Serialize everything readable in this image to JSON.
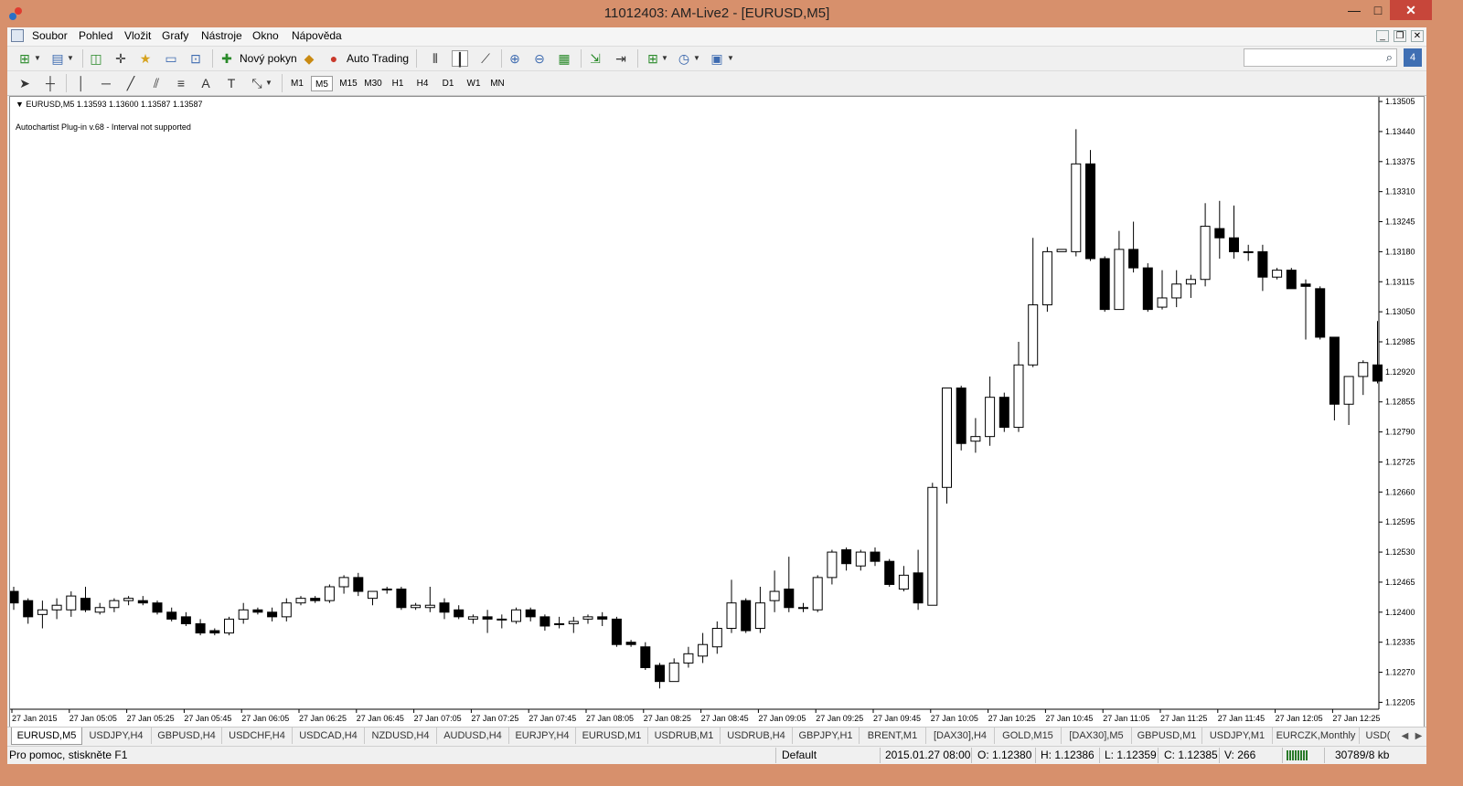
{
  "window": {
    "title": "11012403: AM-Live2 - [EURUSD,M5]",
    "minimize_icon": "minimize-icon",
    "maximize_icon": "maximize-icon",
    "close_icon": "close-icon"
  },
  "menu": {
    "items": [
      "Soubor",
      "Pohled",
      "Vložit",
      "Grafy",
      "Nástroje",
      "Okno",
      "Nápověda"
    ]
  },
  "toolbar": {
    "new_order_label": "Nový pokyn",
    "auto_trading_label": "Auto Trading",
    "search_placeholder": ""
  },
  "timeframes": {
    "items": [
      "M1",
      "M5",
      "M15",
      "M30",
      "H1",
      "H4",
      "D1",
      "W1",
      "MN"
    ],
    "active": "M5"
  },
  "chart": {
    "header": "EURUSD,M5  1.13593 1.13600 1.13587 1.13587",
    "subtitle": "Autochartist Plug-in v.68 - Interval not supported"
  },
  "chart_data": {
    "type": "candlestick",
    "symbol": "EURUSD,M5",
    "ylim": [
      1.1219,
      1.13515
    ],
    "y_ticks": [
      "1.13505",
      "1.13440",
      "1.13375",
      "1.13310",
      "1.13245",
      "1.13180",
      "1.13115",
      "1.13050",
      "1.12985",
      "1.12920",
      "1.12855",
      "1.12790",
      "1.12725",
      "1.12660",
      "1.12595",
      "1.12530",
      "1.12465",
      "1.12400",
      "1.12335",
      "1.12270",
      "1.12205"
    ],
    "x_ticks": [
      "27 Jan 2015",
      "27 Jan 05:05",
      "27 Jan 05:25",
      "27 Jan 05:45",
      "27 Jan 06:05",
      "27 Jan 06:25",
      "27 Jan 06:45",
      "27 Jan 07:05",
      "27 Jan 07:25",
      "27 Jan 07:45",
      "27 Jan 08:05",
      "27 Jan 08:25",
      "27 Jan 08:45",
      "27 Jan 09:05",
      "27 Jan 09:25",
      "27 Jan 09:45",
      "27 Jan 10:05",
      "27 Jan 10:25",
      "27 Jan 10:45",
      "27 Jan 11:05",
      "27 Jan 11:25",
      "27 Jan 11:45",
      "27 Jan 12:05",
      "27 Jan 12:25"
    ],
    "grid": false,
    "candles": [
      [
        1.12445,
        1.12455,
        1.12405,
        1.1242
      ],
      [
        1.12425,
        1.1243,
        1.12375,
        1.1239
      ],
      [
        1.12395,
        1.12425,
        1.12365,
        1.12405
      ],
      [
        1.12405,
        1.1243,
        1.12385,
        1.12415
      ],
      [
        1.12405,
        1.12445,
        1.1239,
        1.12435
      ],
      [
        1.1243,
        1.12455,
        1.124,
        1.12405
      ],
      [
        1.124,
        1.1242,
        1.12395,
        1.1241
      ],
      [
        1.1241,
        1.1243,
        1.124,
        1.12425
      ],
      [
        1.12425,
        1.12435,
        1.12415,
        1.1243
      ],
      [
        1.12425,
        1.12435,
        1.12415,
        1.1242
      ],
      [
        1.1242,
        1.12425,
        1.12395,
        1.124
      ],
      [
        1.124,
        1.1241,
        1.1238,
        1.12385
      ],
      [
        1.1239,
        1.124,
        1.1237,
        1.12375
      ],
      [
        1.12375,
        1.12385,
        1.1235,
        1.12355
      ],
      [
        1.1236,
        1.12365,
        1.1235,
        1.12355
      ],
      [
        1.12355,
        1.1239,
        1.1235,
        1.12385
      ],
      [
        1.12385,
        1.1242,
        1.12375,
        1.12405
      ],
      [
        1.12405,
        1.1241,
        1.12395,
        1.124
      ],
      [
        1.124,
        1.1241,
        1.1238,
        1.1239
      ],
      [
        1.1239,
        1.1243,
        1.1238,
        1.1242
      ],
      [
        1.1242,
        1.12435,
        1.12415,
        1.1243
      ],
      [
        1.1243,
        1.12435,
        1.1242,
        1.12425
      ],
      [
        1.12425,
        1.1246,
        1.1242,
        1.12455
      ],
      [
        1.12455,
        1.1248,
        1.1244,
        1.12475
      ],
      [
        1.12475,
        1.12485,
        1.12435,
        1.12445
      ],
      [
        1.1243,
        1.12445,
        1.12415,
        1.12445
      ],
      [
        1.1245,
        1.12455,
        1.1244,
        1.1245
      ],
      [
        1.1245,
        1.12455,
        1.12405,
        1.1241
      ],
      [
        1.1241,
        1.1242,
        1.12405,
        1.12415
      ],
      [
        1.1241,
        1.12455,
        1.124,
        1.12415
      ],
      [
        1.1242,
        1.1243,
        1.12385,
        1.124
      ],
      [
        1.12405,
        1.12415,
        1.12385,
        1.1239
      ],
      [
        1.12385,
        1.12395,
        1.12375,
        1.1239
      ],
      [
        1.1239,
        1.12405,
        1.12355,
        1.12385
      ],
      [
        1.12385,
        1.12395,
        1.12365,
        1.12385
      ],
      [
        1.1238,
        1.1241,
        1.12375,
        1.12405
      ],
      [
        1.12405,
        1.1241,
        1.1238,
        1.1239
      ],
      [
        1.1239,
        1.12395,
        1.1236,
        1.1237
      ],
      [
        1.12375,
        1.1239,
        1.12365,
        1.12375
      ],
      [
        1.12375,
        1.1239,
        1.12355,
        1.1238
      ],
      [
        1.12385,
        1.12395,
        1.12375,
        1.1239
      ],
      [
        1.1239,
        1.124,
        1.1237,
        1.12385
      ],
      [
        1.12385,
        1.1239,
        1.12325,
        1.1233
      ],
      [
        1.12335,
        1.1234,
        1.12325,
        1.1233
      ],
      [
        1.12325,
        1.12335,
        1.12275,
        1.1228
      ],
      [
        1.12285,
        1.1229,
        1.12235,
        1.1225
      ],
      [
        1.1225,
        1.123,
        1.1225,
        1.1229
      ],
      [
        1.1229,
        1.12325,
        1.1228,
        1.1231
      ],
      [
        1.12305,
        1.12355,
        1.1229,
        1.1233
      ],
      [
        1.12325,
        1.1238,
        1.1231,
        1.12365
      ],
      [
        1.12365,
        1.1247,
        1.12355,
        1.1242
      ],
      [
        1.12425,
        1.1243,
        1.12355,
        1.1236
      ],
      [
        1.12365,
        1.12455,
        1.12355,
        1.1242
      ],
      [
        1.12425,
        1.1249,
        1.124,
        1.12445
      ],
      [
        1.1245,
        1.1252,
        1.124,
        1.1241
      ],
      [
        1.1241,
        1.1242,
        1.124,
        1.1241
      ],
      [
        1.12405,
        1.1248,
        1.124,
        1.12475
      ],
      [
        1.12475,
        1.12535,
        1.1246,
        1.1253
      ],
      [
        1.12535,
        1.1254,
        1.1249,
        1.12505
      ],
      [
        1.125,
        1.12535,
        1.1249,
        1.1253
      ],
      [
        1.1253,
        1.1254,
        1.125,
        1.1251
      ],
      [
        1.1251,
        1.12515,
        1.12455,
        1.1246
      ],
      [
        1.1245,
        1.125,
        1.12445,
        1.1248
      ],
      [
        1.12485,
        1.12535,
        1.12405,
        1.1242
      ],
      [
        1.12415,
        1.1268,
        1.12415,
        1.1267
      ],
      [
        1.1267,
        1.12885,
        1.12635,
        1.12885
      ],
      [
        1.12885,
        1.1289,
        1.1275,
        1.12765
      ],
      [
        1.1277,
        1.1282,
        1.12745,
        1.1278
      ],
      [
        1.1278,
        1.1291,
        1.1276,
        1.12865
      ],
      [
        1.12865,
        1.12875,
        1.1279,
        1.128
      ],
      [
        1.128,
        1.12985,
        1.1279,
        1.12935
      ],
      [
        1.12935,
        1.1321,
        1.1293,
        1.13065
      ],
      [
        1.13065,
        1.1319,
        1.1305,
        1.1318
      ],
      [
        1.1318,
        1.13185,
        1.1318,
        1.13185
      ],
      [
        1.1318,
        1.13445,
        1.1317,
        1.1337
      ],
      [
        1.1337,
        1.134,
        1.1316,
        1.13165
      ],
      [
        1.13165,
        1.1317,
        1.1305,
        1.13055
      ],
      [
        1.13055,
        1.13225,
        1.13055,
        1.13185
      ],
      [
        1.13185,
        1.13245,
        1.13135,
        1.13145
      ],
      [
        1.13145,
        1.13155,
        1.1305,
        1.13055
      ],
      [
        1.1306,
        1.1314,
        1.13055,
        1.1308
      ],
      [
        1.1308,
        1.1314,
        1.1306,
        1.1311
      ],
      [
        1.1311,
        1.1313,
        1.1308,
        1.1312
      ],
      [
        1.1312,
        1.13285,
        1.13105,
        1.13235
      ],
      [
        1.1323,
        1.1329,
        1.13165,
        1.1321
      ],
      [
        1.1321,
        1.1328,
        1.13165,
        1.1318
      ],
      [
        1.1318,
        1.13195,
        1.1316,
        1.1318
      ],
      [
        1.1318,
        1.13195,
        1.13095,
        1.13125
      ],
      [
        1.13125,
        1.13145,
        1.1312,
        1.1314
      ],
      [
        1.1314,
        1.13145,
        1.13105,
        1.131
      ],
      [
        1.1311,
        1.1312,
        1.1299,
        1.13105
      ],
      [
        1.131,
        1.13105,
        1.1299,
        1.12995
      ],
      [
        1.12995,
        1.12995,
        1.12815,
        1.1285
      ],
      [
        1.1285,
        1.1291,
        1.12805,
        1.1291
      ],
      [
        1.1291,
        1.12945,
        1.1287,
        1.1294
      ],
      [
        1.12935,
        1.1303,
        1.12895,
        1.129
      ]
    ],
    "candle_order": [
      "open",
      "high",
      "low",
      "close"
    ]
  },
  "tabs": {
    "items": [
      "EURUSD,M5",
      "USDJPY,H4",
      "GBPUSD,H4",
      "USDCHF,H4",
      "USDCAD,H4",
      "NZDUSD,H4",
      "AUDUSD,H4",
      "EURJPY,H4",
      "EURUSD,M1",
      "USDRUB,M1",
      "USDRUB,H4",
      "GBPJPY,H1",
      "BRENT,M1",
      "[DAX30],H4",
      "GOLD,M15",
      "[DAX30],M5",
      "GBPUSD,M1",
      "USDJPY,M1",
      "EURCZK,Monthly",
      "USD("
    ],
    "scroll_left": "◀",
    "scroll_right": "▶"
  },
  "status": {
    "help": "Pro pomoc, stiskněte F1",
    "profile": "Default",
    "datetime": "2015.01.27 08:00",
    "open": "O: 1.12380",
    "high": "H: 1.12386",
    "low": "L: 1.12359",
    "close": "C: 1.12385",
    "volume": "V: 266",
    "traffic": "30789/8 kb"
  }
}
